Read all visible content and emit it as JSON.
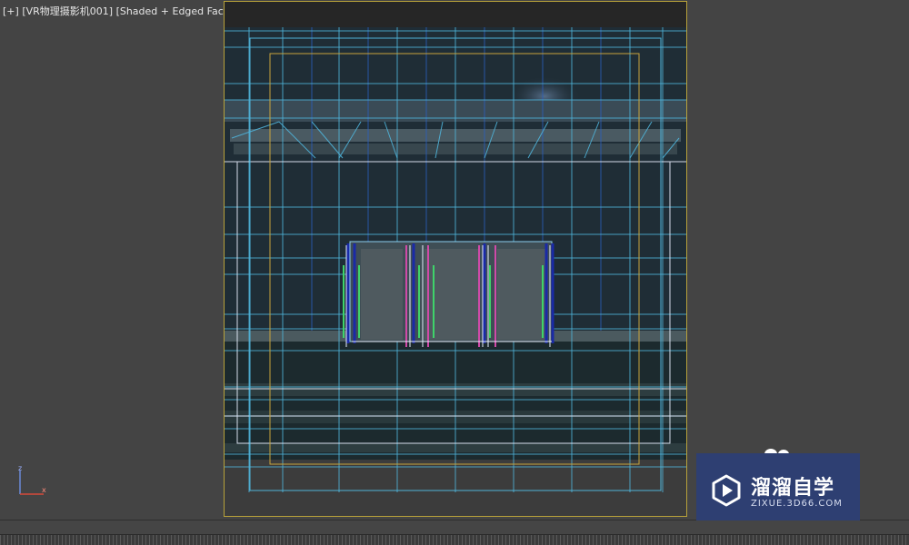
{
  "viewport": {
    "label_parts": [
      "[+]",
      "[VR物理摄影机001]",
      "[Shaded + Edged Faces]"
    ]
  },
  "axis": {
    "z_label": "z",
    "x_label": "x"
  },
  "watermark": {
    "title": "溜溜自学",
    "subtitle": "ZIXUE.3D66.COM",
    "logo_icon": "play-icon"
  },
  "colors": {
    "viewport_bg": "#444444",
    "safe_frame": "#b8a23a",
    "wire_cyan": "#4fb3d9",
    "wire_blue": "#2a5fc0",
    "wire_green": "#3fd36a",
    "wire_magenta": "#d04aa8",
    "wire_white": "#e8f0ff",
    "watermark_bg": "#2e3f72"
  }
}
